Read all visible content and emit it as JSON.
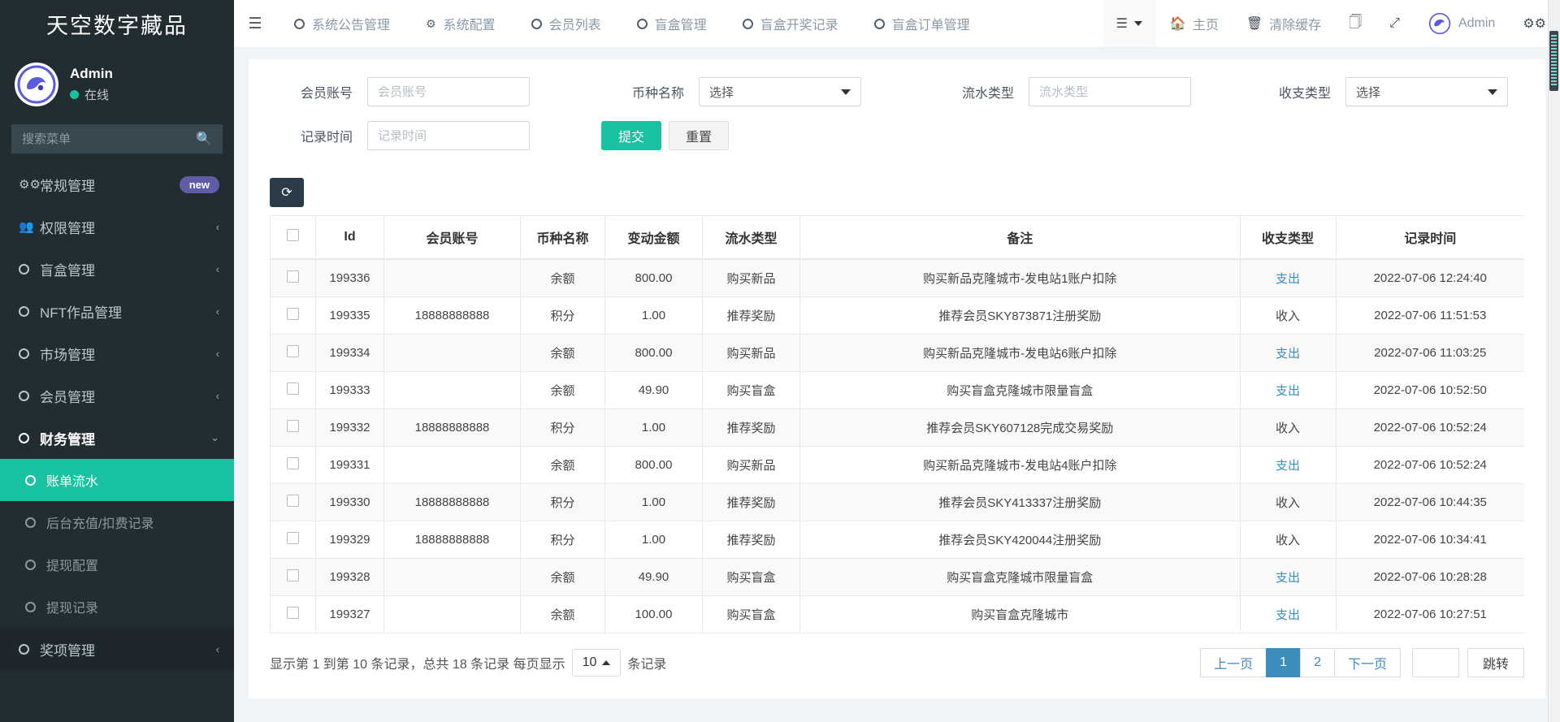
{
  "sidebar": {
    "brand": "天空数字藏品",
    "user": {
      "name": "Admin",
      "status": "在线"
    },
    "search": {
      "placeholder": "搜索菜单",
      "value": ""
    },
    "items": [
      {
        "label": "常规管理",
        "icon": "cogs-icon",
        "badge": "new",
        "arrow": ""
      },
      {
        "label": "权限管理",
        "icon": "users-icon",
        "badge": "",
        "arrow": "‹"
      },
      {
        "label": "盲盒管理",
        "icon": "circle-icon",
        "badge": "",
        "arrow": "‹"
      },
      {
        "label": "NFT作品管理",
        "icon": "circle-icon",
        "badge": "",
        "arrow": "‹"
      },
      {
        "label": "市场管理",
        "icon": "circle-icon",
        "badge": "",
        "arrow": "‹"
      },
      {
        "label": "会员管理",
        "icon": "circle-icon",
        "badge": "",
        "arrow": "‹"
      },
      {
        "label": "财务管理",
        "icon": "circle-icon",
        "badge": "",
        "arrow": "⌄"
      },
      {
        "label": "账单流水",
        "icon": "circle-icon",
        "badge": "",
        "arrow": ""
      },
      {
        "label": "后台充值/扣费记录",
        "icon": "circle-icon",
        "badge": "",
        "arrow": ""
      },
      {
        "label": "提现配置",
        "icon": "circle-icon",
        "badge": "",
        "arrow": ""
      },
      {
        "label": "提现记录",
        "icon": "circle-icon",
        "badge": "",
        "arrow": ""
      },
      {
        "label": "奖项管理",
        "icon": "circle-icon",
        "badge": "",
        "arrow": "‹"
      }
    ]
  },
  "topbar": {
    "menu_toggle": "☰",
    "tabs": [
      {
        "label": "系统公告管理",
        "icon": "circle-icon"
      },
      {
        "label": "系统配置",
        "icon": "gear-icon"
      },
      {
        "label": "会员列表",
        "icon": "circle-icon"
      },
      {
        "label": "盲盒管理",
        "icon": "circle-icon"
      },
      {
        "label": "盲盒开奖记录",
        "icon": "circle-icon"
      },
      {
        "label": "盲盒订单管理",
        "icon": "circle-icon"
      }
    ],
    "right": [
      {
        "label": "",
        "icon": "list-dropdown-icon"
      },
      {
        "label": "主页",
        "icon": "home-icon"
      },
      {
        "label": "清除缓存",
        "icon": "trash-icon"
      },
      {
        "label": "",
        "icon": "window-restore-icon"
      },
      {
        "label": "",
        "icon": "expand-icon"
      },
      {
        "label": "Admin",
        "icon": "avatar-icon"
      },
      {
        "label": "",
        "icon": "cogs-icon"
      }
    ]
  },
  "filter": {
    "account": {
      "label": "会员账号",
      "placeholder": "会员账号",
      "value": ""
    },
    "coin": {
      "label": "币种名称",
      "selected": "选择"
    },
    "flow_type": {
      "label": "流水类型",
      "placeholder": "流水类型",
      "value": ""
    },
    "io_type": {
      "label": "收支类型",
      "selected": "选择"
    },
    "record_time": {
      "label": "记录时间",
      "placeholder": "记录时间",
      "value": ""
    },
    "submit_label": "提交",
    "reset_label": "重置"
  },
  "toolbar": {
    "refresh_icon": "refresh-icon"
  },
  "table": {
    "columns": [
      "",
      "Id",
      "会员账号",
      "币种名称",
      "变动金额",
      "流水类型",
      "备注",
      "收支类型",
      "记录时间"
    ],
    "rows": [
      {
        "id": "199336",
        "account": "",
        "coin": "余额",
        "amount": "800.00",
        "flow": "购买新品",
        "note": "购买新品克隆城市-发电站1账户扣除",
        "io": "支出",
        "io_kind": "out",
        "time": "2022-07-06 12:24:40"
      },
      {
        "id": "199335",
        "account": "18888888888",
        "coin": "积分",
        "amount": "1.00",
        "flow": "推荐奖励",
        "note": "推荐会员SKY873871注册奖励",
        "io": "收入",
        "io_kind": "in",
        "time": "2022-07-06 11:51:53"
      },
      {
        "id": "199334",
        "account": "",
        "coin": "余额",
        "amount": "800.00",
        "flow": "购买新品",
        "note": "购买新品克隆城市-发电站6账户扣除",
        "io": "支出",
        "io_kind": "out",
        "time": "2022-07-06 11:03:25"
      },
      {
        "id": "199333",
        "account": "",
        "coin": "余额",
        "amount": "49.90",
        "flow": "购买盲盒",
        "note": "购买盲盒克隆城市限量盲盒",
        "io": "支出",
        "io_kind": "out",
        "time": "2022-07-06 10:52:50"
      },
      {
        "id": "199332",
        "account": "18888888888",
        "coin": "积分",
        "amount": "1.00",
        "flow": "推荐奖励",
        "note": "推荐会员SKY607128完成交易奖励",
        "io": "收入",
        "io_kind": "in",
        "time": "2022-07-06 10:52:24"
      },
      {
        "id": "199331",
        "account": "",
        "coin": "余额",
        "amount": "800.00",
        "flow": "购买新品",
        "note": "购买新品克隆城市-发电站4账户扣除",
        "io": "支出",
        "io_kind": "out",
        "time": "2022-07-06 10:52:24"
      },
      {
        "id": "199330",
        "account": "18888888888",
        "coin": "积分",
        "amount": "1.00",
        "flow": "推荐奖励",
        "note": "推荐会员SKY413337注册奖励",
        "io": "收入",
        "io_kind": "in",
        "time": "2022-07-06 10:44:35"
      },
      {
        "id": "199329",
        "account": "18888888888",
        "coin": "积分",
        "amount": "1.00",
        "flow": "推荐奖励",
        "note": "推荐会员SKY420044注册奖励",
        "io": "收入",
        "io_kind": "in",
        "time": "2022-07-06 10:34:41"
      },
      {
        "id": "199328",
        "account": "",
        "coin": "余额",
        "amount": "49.90",
        "flow": "购买盲盒",
        "note": "购买盲盒克隆城市限量盲盒",
        "io": "支出",
        "io_kind": "out",
        "time": "2022-07-06 10:28:28"
      },
      {
        "id": "199327",
        "account": "",
        "coin": "余额",
        "amount": "100.00",
        "flow": "购买盲盒",
        "note": "购买盲盒克隆城市",
        "io": "支出",
        "io_kind": "out",
        "time": "2022-07-06 10:27:51"
      }
    ]
  },
  "footer": {
    "summary_prefix": "显示第 1 到第 10 条记录，总共 18 条记录 每页显示",
    "page_size": "10",
    "summary_suffix": "条记录",
    "prev_label": "上一页",
    "pages": [
      "1",
      "2"
    ],
    "next_label": "下一页",
    "jump_value": "",
    "jump_label": "跳转"
  },
  "colors": {
    "accent": "#18c2a0",
    "sidebar_bg": "#222d32",
    "link": "#3c8dbc",
    "badge": "#605ca8"
  }
}
